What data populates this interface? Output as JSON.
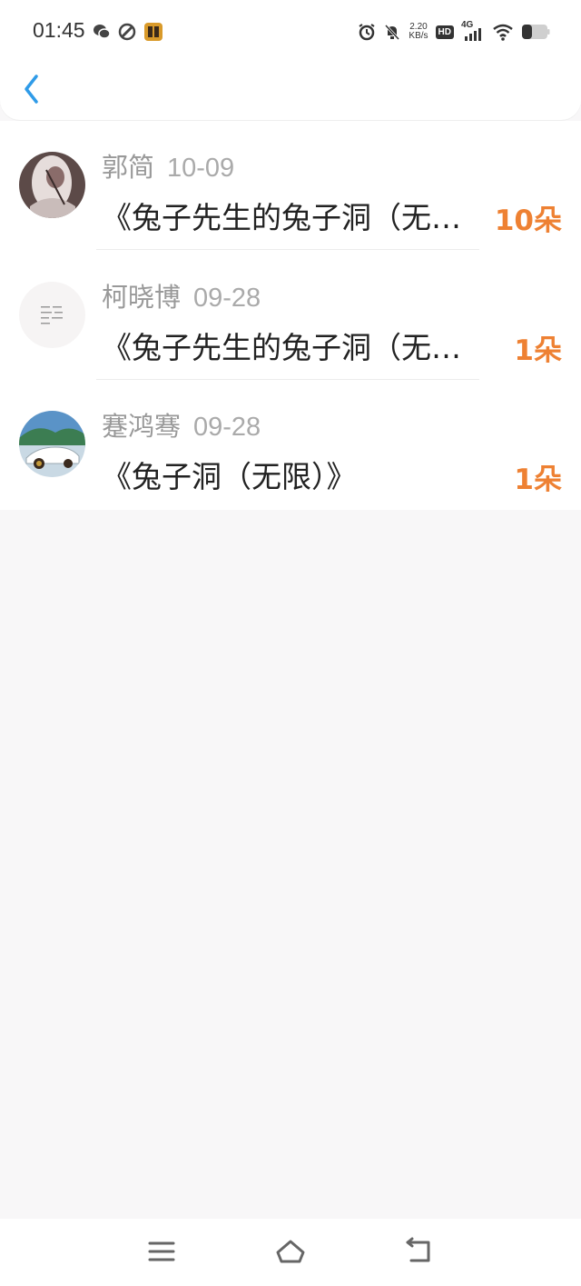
{
  "status_bar": {
    "time": "01:45",
    "speed_value": "2.20",
    "speed_unit": "KB/s",
    "hd_label": "HD",
    "network_label": "4G",
    "icons": [
      "wechat-icon",
      "app-icon",
      "game-icon",
      "alarm-icon",
      "mute-icon",
      "signal-icon",
      "wifi-icon",
      "battery-icon"
    ]
  },
  "header": {
    "back_icon": "chevron-left-icon",
    "accent_color": "#2f9be8"
  },
  "items": [
    {
      "name": "郭简",
      "date": "10-09",
      "title": "《兔子先生的兔子洞（无限）》",
      "count": "10朵"
    },
    {
      "name": "柯晓博",
      "date": "09-28",
      "title": "《兔子先生的兔子洞（无限）》",
      "count": "1朵"
    },
    {
      "name": "蹇鸿骞",
      "date": "09-28",
      "title": "《兔子洞（无限）》",
      "count": "1朵"
    }
  ],
  "colors": {
    "count": "#ee8133",
    "background": "#f8f7f8"
  },
  "nav": {
    "icons": [
      "menu-icon",
      "home-icon",
      "back-icon"
    ]
  }
}
